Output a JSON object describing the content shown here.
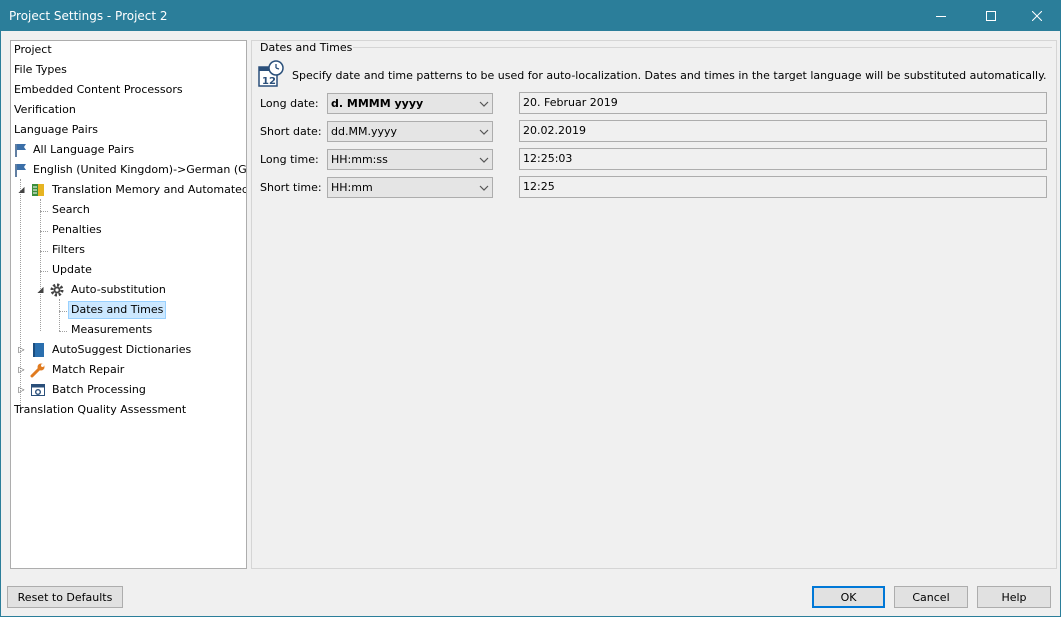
{
  "window": {
    "title": "Project Settings - Project 2",
    "controls": {
      "minimize": "minimize-icon",
      "maximize": "maximize-icon",
      "close": "close-icon"
    }
  },
  "tree": {
    "items": [
      {
        "label": "Project"
      },
      {
        "label": "File Types"
      },
      {
        "label": "Embedded Content Processors"
      },
      {
        "label": "Verification"
      },
      {
        "label": "Language Pairs"
      },
      {
        "label": "All Language Pairs",
        "icon": "flag-icon"
      },
      {
        "label": "English (United Kingdom)->German (Ger",
        "icon": "flag-icon"
      },
      {
        "label": "Translation Memory and Automated Tr",
        "icon": "translation-memory-icon"
      },
      {
        "label": "Search"
      },
      {
        "label": "Penalties"
      },
      {
        "label": "Filters"
      },
      {
        "label": "Update"
      },
      {
        "label": "Auto-substitution",
        "icon": "gear-icon"
      },
      {
        "label": "Dates and Times",
        "selected": true
      },
      {
        "label": "Measurements"
      },
      {
        "label": "AutoSuggest Dictionaries",
        "icon": "book-icon"
      },
      {
        "label": "Match Repair",
        "icon": "wrench-icon"
      },
      {
        "label": "Batch Processing",
        "icon": "batch-icon"
      },
      {
        "label": "Translation Quality Assessment"
      }
    ]
  },
  "panel": {
    "title": "Dates and Times",
    "description": "Specify date and time patterns to be used for auto-localization. Dates and times in the target language will be substituted automatically.",
    "fields": [
      {
        "label": "Long date:",
        "pattern": "d. MMMM yyyy",
        "sample": "20. Februar 2019"
      },
      {
        "label": "Short date:",
        "pattern": "dd.MM.yyyy",
        "sample": "20.02.2019"
      },
      {
        "label": "Long time:",
        "pattern": "HH:mm:ss",
        "sample": "12:25:03"
      },
      {
        "label": "Short time:",
        "pattern": "HH:mm",
        "sample": "12:25"
      }
    ]
  },
  "buttons": {
    "reset": "Reset to Defaults",
    "ok": "OK",
    "cancel": "Cancel",
    "help": "Help"
  },
  "colors": {
    "titlebar": "#2b7e9a",
    "selection": "#cce8ff",
    "accent": "#0078d7"
  }
}
